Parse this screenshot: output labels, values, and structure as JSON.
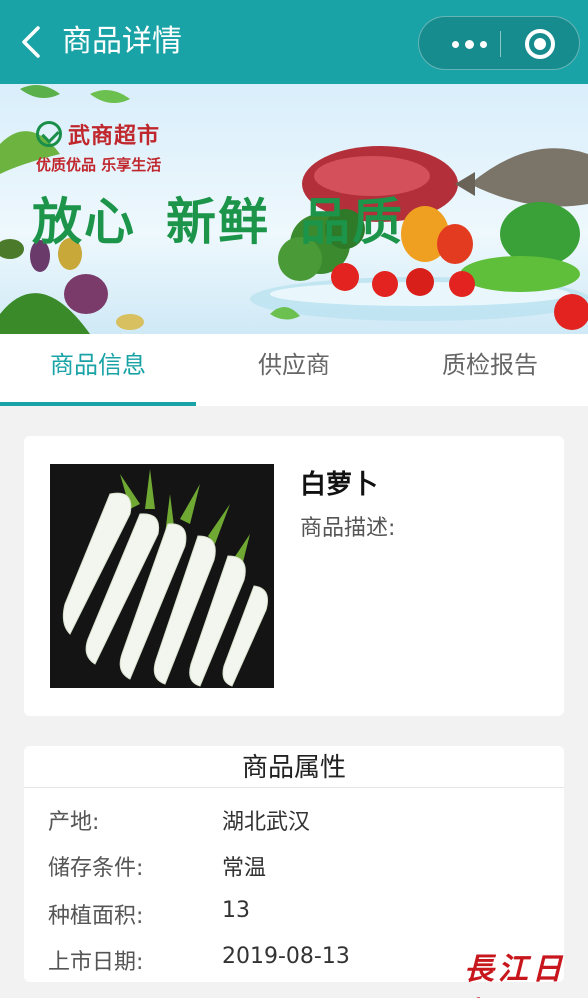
{
  "nav": {
    "title": "商品详情"
  },
  "banner": {
    "logo_name": "武商超市",
    "logo_slogan": "优质优品 乐享生活",
    "slogan_words": [
      "放心",
      "新鲜",
      "品质"
    ]
  },
  "tabs": [
    {
      "label": "商品信息",
      "active": true
    },
    {
      "label": "供应商",
      "active": false
    },
    {
      "label": "质检报告",
      "active": false
    }
  ],
  "product": {
    "name": "白萝卜",
    "description_label": "商品描述:"
  },
  "attributes": {
    "title": "商品属性",
    "rows": [
      {
        "key": "产地:",
        "value": "湖北武汉"
      },
      {
        "key": "储存条件:",
        "value": "常温"
      },
      {
        "key": "种植面积:",
        "value": "13"
      },
      {
        "key": "上市日期:",
        "value": "2019-08-13"
      }
    ]
  },
  "watermark": "長江日報",
  "colors": {
    "accent": "#1aa3a6",
    "brand_red": "#c0272d",
    "slogan_green": "#1c9449"
  }
}
